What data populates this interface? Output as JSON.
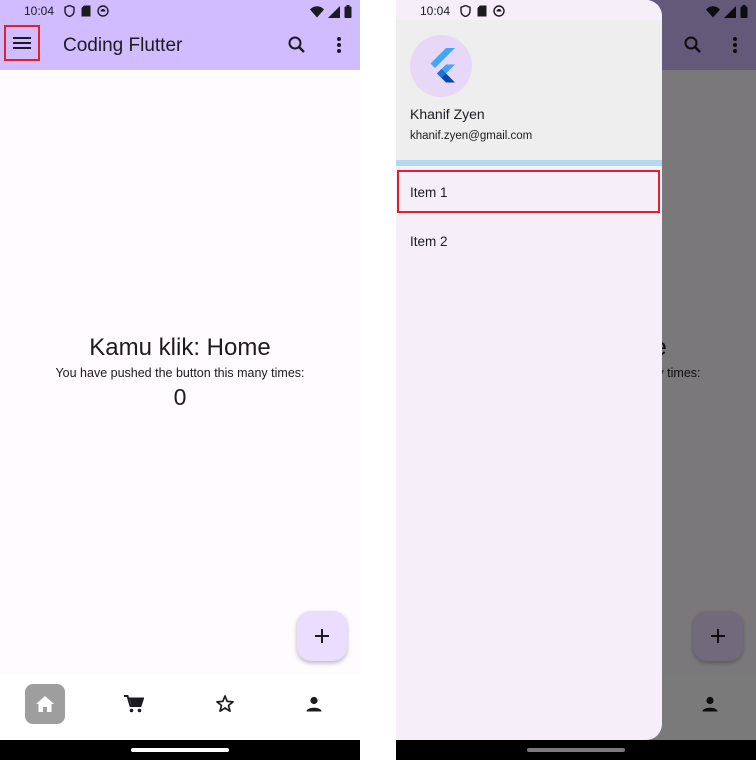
{
  "status": {
    "time": "10:04"
  },
  "appbar": {
    "title": "Coding Flutter"
  },
  "main": {
    "headline": "Kamu klik: Home",
    "subtext": "You have pushed the button this many times:",
    "counter": "0"
  },
  "fab": {
    "icon": "add-icon"
  },
  "bottom_nav": {
    "items": [
      "home-icon",
      "cart-icon",
      "star-icon",
      "person-icon"
    ],
    "selected": "home-icon"
  },
  "drawer": {
    "account_name": "Khanif Zyen",
    "account_email": "khanif.zyen@gmail.com",
    "avatar_icon": "flutter-logo-icon",
    "items": [
      {
        "label": "Item 1"
      },
      {
        "label": "Item 2"
      }
    ]
  },
  "colors": {
    "appbar": "#d0bcff",
    "highlight": "#e0202a",
    "drawer": "#f6effa",
    "drawer_header": "#eeeeee"
  }
}
